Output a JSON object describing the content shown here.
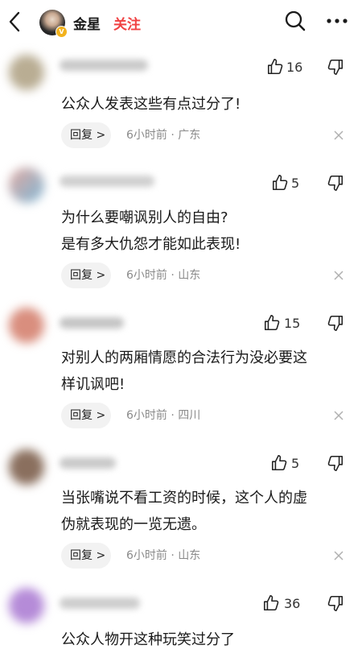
{
  "header": {
    "user_name": "金星",
    "follow_label": "关注"
  },
  "comments": [
    {
      "likes": "16",
      "text": "公众人发表这些有点过分了!",
      "reply_label": "回复 >",
      "time": "6小时前",
      "location": "广东"
    },
    {
      "likes": "5",
      "text": "为什么要嘲讽别人的自由?\n是有多大仇怨才能如此表现!",
      "reply_label": "回复 >",
      "time": "6小时前",
      "location": "山东"
    },
    {
      "likes": "15",
      "text": "对别人的两厢情愿的合法行为没必要这\n样讥讽吧!",
      "reply_label": "回复 >",
      "time": "6小时前",
      "location": "四川"
    },
    {
      "likes": "5",
      "text": "当张嘴说不看工资的时候，这个人的虚\n伪就表现的一览无遗。",
      "reply_label": "回复 >",
      "time": "6小时前",
      "location": "山东"
    },
    {
      "likes": "36",
      "text": "公众人物开这种玩笑过分了"
    }
  ],
  "colors": {
    "accent": "#f04142",
    "meta_text": "#8a8a8a",
    "reply_bg": "#f2f2f2"
  }
}
